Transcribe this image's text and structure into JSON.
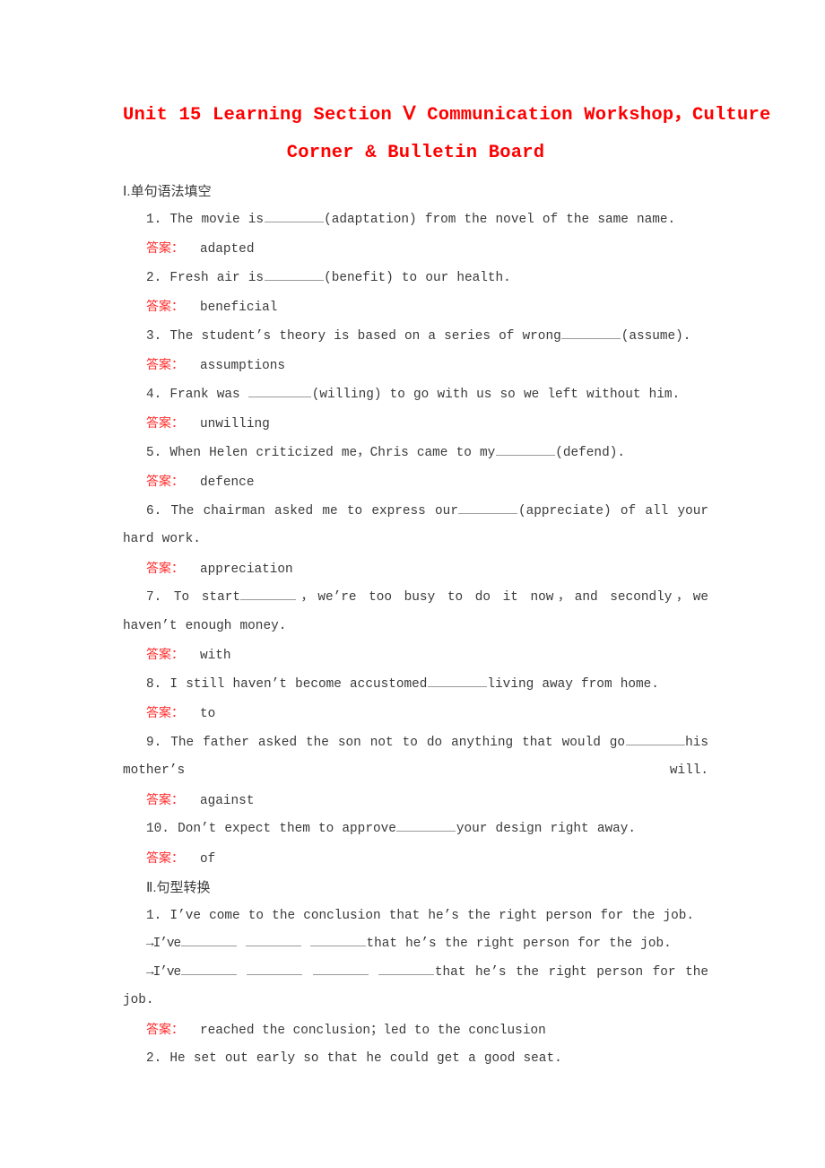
{
  "document": {
    "title_line1": "Unit 15 Learning Section Ⅴ Communication Workshop，Culture",
    "title_line2": "Corner & Bulletin Board",
    "title_color": "#ff0000",
    "answer_label_color": "#ff2a2a",
    "body_text_color": "#3a3a3a",
    "background_color": "#ffffff"
  },
  "sections": [
    {
      "heading": "Ⅰ.单句语法填空",
      "answer_label": "答案：",
      "items": [
        {
          "number": "1.",
          "pre": "The movie is",
          "post": "(adaptation) from the novel of the same name.",
          "answer": "adapted"
        },
        {
          "number": "2.",
          "pre": "Fresh air is",
          "post": "(benefit) to our health.",
          "answer": "beneficial"
        },
        {
          "number": "3.",
          "pre": "The student’s theory is based on a series of wrong",
          "post": "(assume).",
          "answer": "assumptions"
        },
        {
          "number": "4.",
          "pre": "Frank was ",
          "post": "(willing) to go with us so we left without him.",
          "answer": "unwilling"
        },
        {
          "number": "5.",
          "pre": "When Helen criticized me，Chris came to my",
          "post": "(defend).",
          "answer": "defence"
        },
        {
          "number": "6.",
          "pre": "The chairman asked me to express our",
          "post": "(appreciate) of all your hard work.",
          "answer": "appreciation"
        },
        {
          "number": "7.",
          "pre": "To start",
          "post": "，we’re too busy to do it now，and secondly，we haven’t enough money.",
          "answer": "with"
        },
        {
          "number": "8.",
          "pre": "I still haven’t become accustomed",
          "post": "living away from home.",
          "answer": "to"
        },
        {
          "number": "9.",
          "pre": "The father asked the son not to do anything that would go",
          "post": "his mother’s will.",
          "answer": "against"
        },
        {
          "number": "10.",
          "pre": "Don’t expect them to approve",
          "post": "your design right away.",
          "answer": "of"
        }
      ]
    },
    {
      "heading": "Ⅱ.句型转换",
      "answer_label": "答案：",
      "items": [
        {
          "number": "1.",
          "original": "I’ve come to the conclusion that he’s the right person for the job.",
          "transform_1_pre": "→I’ve",
          "transform_1_post": "that he’s the right person for the job.",
          "transform_1_blanks": 3,
          "transform_2_pre": "→I’ve",
          "transform_2_post": "that he’s the right person for the job.",
          "transform_2_blanks": 4,
          "answer": "reached the conclusion；led to the conclusion"
        },
        {
          "number": "2.",
          "original": "He set out early so that he could get a good seat."
        }
      ]
    }
  ]
}
